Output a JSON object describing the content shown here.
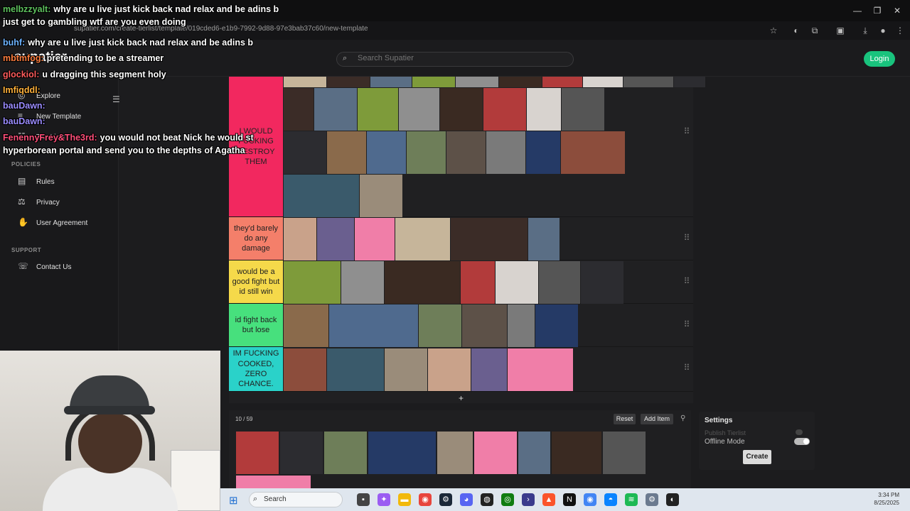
{
  "browser": {
    "url": "supatier.com/create-tierlist/template/019cded6-e1b9-7992-9d88-97e3bab37c60/new-template",
    "window_controls": [
      "—",
      "❐",
      "✕"
    ]
  },
  "header": {
    "logo": "supatier",
    "search_placeholder": "Search Supatier",
    "login_label": "Login"
  },
  "sidebar": {
    "main_items": [
      {
        "label": "Explore",
        "icon": "compass-icon"
      },
      {
        "label": "New Template",
        "icon": "plus-list-icon"
      },
      {
        "label": "Tier Lists",
        "icon": "list-icon"
      }
    ],
    "policies_title": "POLICIES",
    "policies": [
      {
        "label": "Rules",
        "icon": "rules-icon"
      },
      {
        "label": "Privacy",
        "icon": "scale-icon"
      },
      {
        "label": "User Agreement",
        "icon": "handshake-icon"
      }
    ],
    "support_title": "SUPPORT",
    "support": [
      {
        "label": "Contact Us",
        "icon": "contact-icon"
      }
    ]
  },
  "tiers": [
    {
      "label": "I WOULD FUCKING DESTROY THEM",
      "color": "#f2285f"
    },
    {
      "label": "they'd barely do any damage",
      "color": "#f47f6a"
    },
    {
      "label": "would be a good fight but id still win",
      "color": "#f5d94a"
    },
    {
      "label": "id fight back but lose",
      "color": "#47e07d"
    },
    {
      "label": "IM FUCKING COOKED, ZERO CHANCE.",
      "color": "#2ad2c9"
    }
  ],
  "tier_add": "+",
  "thumb_colors": [
    "#3b2c27",
    "#5a6e85",
    "#7e9b3a",
    "#8f8f8f",
    "#3a2a22",
    "#b23b3b",
    "#d8d3cf",
    "#555",
    "#2c2c30",
    "#8a6a4b",
    "#4f6a8e",
    "#6e7e59",
    "#5d5148",
    "#7a7a7a",
    "#253a66",
    "#8c4d3c",
    "#3a5a6b",
    "#9a8c7a",
    "#c9a28a",
    "#6a5f8f",
    "#f07ea8",
    "#c6b59a"
  ],
  "pool": {
    "count": "10 / 59",
    "reset_label": "Reset",
    "add_item_label": "Add Item"
  },
  "settings": {
    "title": "Settings",
    "publish_label": "Publish Tierlist",
    "offline_label": "Offline Mode",
    "create_label": "Create"
  },
  "chat": [
    {
      "user": "melbzzyalt:",
      "color": "#5ec25e",
      "msg": "why are u live just kick back nad relax and be adins b"
    },
    {
      "user": "",
      "color": "#ffffff",
      "msg": "just get to gambling wtf are you even doing"
    },
    {
      "user": "buhf:",
      "color": "#6db3ff",
      "msg": "why are u live just kick back nad relax and be adins b"
    },
    {
      "user": "mbtmfog:",
      "color": "#ff7e3f",
      "msg": "pretending to be a streamer"
    },
    {
      "user": "glockiol:",
      "color": "#ff5c5c",
      "msg": "u dragging this segment holy"
    },
    {
      "user": "Imfiqddl:",
      "color": "#ffb13b",
      "msg": ""
    },
    {
      "user": "bauDawn:",
      "color": "#9b8cff",
      "msg": ""
    },
    {
      "user": "bauDawn:",
      "color": "#9b8cff",
      "msg": ""
    },
    {
      "user": "FenennyFrey&The3rd:",
      "color": "#ff4f7a",
      "msg": "you would not beat Nick he would st"
    },
    {
      "user": "",
      "color": "#ffffff",
      "msg": "hyperborean portal and send you to the depths of Agatha"
    }
  ],
  "taskbar": {
    "search_label": "Search",
    "time": "3:34 PM",
    "date": "8/25/2025"
  }
}
